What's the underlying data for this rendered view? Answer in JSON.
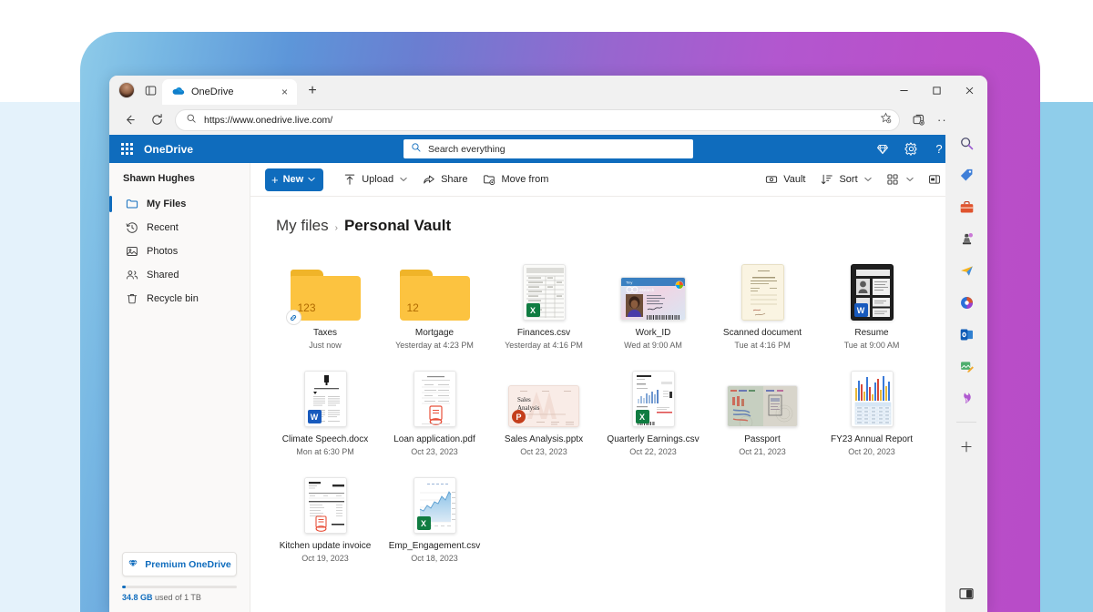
{
  "browser": {
    "tab": {
      "title": "OneDrive",
      "favicon": "onedrive-cloud-icon",
      "close": "×"
    },
    "new_tab_label": "+",
    "window_controls": {
      "minimize": "–",
      "maximize": "☐",
      "close": "✕"
    },
    "url": "https://www.onedrive.live.com/",
    "nav": {
      "back": "←",
      "refresh": "⟳"
    },
    "toolbar_right": {
      "favorites": "favorites-add-icon",
      "collections": "collections-icon",
      "settings_more": "···",
      "copilot": "b"
    }
  },
  "onedrive_header": {
    "app_launcher": "waffle-icon",
    "brand": "OneDrive",
    "search_placeholder": "Search everything",
    "actions": [
      {
        "name": "premium-diamond-icon",
        "glyph": "◇"
      },
      {
        "name": "settings-gear-icon",
        "glyph": "⚙"
      },
      {
        "name": "help-icon",
        "glyph": "?"
      }
    ]
  },
  "sidebar": {
    "user_name": "Shawn Hughes",
    "items": [
      {
        "label": "My Files",
        "icon": "folder-icon",
        "active": true
      },
      {
        "label": "Recent",
        "icon": "clock-history-icon",
        "active": false
      },
      {
        "label": "Photos",
        "icon": "photo-icon",
        "active": false
      },
      {
        "label": "Shared",
        "icon": "people-icon",
        "active": false
      },
      {
        "label": "Recycle bin",
        "icon": "trash-icon",
        "active": false
      }
    ],
    "premium_button": "Premium OneDrive",
    "storage_used": "34.8 GB",
    "storage_suffix": "used of 1 TB",
    "storage_percent": 3.4
  },
  "command_bar": {
    "new_label": "New",
    "new_chevron": "⌄",
    "items": [
      {
        "label": "Upload",
        "icon": "upload-icon",
        "chevron": "⌄"
      },
      {
        "label": "Share",
        "icon": "share-icon",
        "chevron": ""
      },
      {
        "label": "Move from",
        "icon": "move-from-icon",
        "chevron": ""
      }
    ],
    "right_items": [
      {
        "label": "Vault",
        "icon": "vault-icon",
        "chevron": ""
      },
      {
        "label": "Sort",
        "icon": "sort-icon",
        "chevron": "⌄"
      },
      {
        "label": "",
        "icon": "view-tiles-icon",
        "chevron": "⌄"
      },
      {
        "label": "Info",
        "icon": "info-panel-icon",
        "chevron": ""
      }
    ]
  },
  "breadcrumb": {
    "parent": "My files",
    "separator": "›",
    "current": "Personal Vault"
  },
  "files": [
    {
      "name": "Taxes",
      "date": "Just now",
      "kind": "folder",
      "count": "123",
      "shared": true
    },
    {
      "name": "Mortgage",
      "date": "Yesterday at 4:23 PM",
      "kind": "folder",
      "count": "12",
      "shared": false
    },
    {
      "name": "Finances.csv",
      "date": "Yesterday at 4:16 PM",
      "kind": "doc",
      "badge": "excel",
      "badge_text": "X",
      "thumb": "tax-form"
    },
    {
      "name": "Work_ID",
      "date": "Wed at 9:00 AM",
      "kind": "image-wide",
      "badge": "",
      "badge_text": "",
      "thumb": "id-card"
    },
    {
      "name": "Scanned document",
      "date": "Tue at 4:16 PM",
      "kind": "doc",
      "badge": "",
      "badge_text": "",
      "thumb": "scanned-letter"
    },
    {
      "name": "Resume",
      "date": "Tue at 9:00 AM",
      "kind": "doc",
      "badge": "word",
      "badge_text": "W",
      "thumb": "resume-dark"
    },
    {
      "name": "Climate Speech.docx",
      "date": "Mon at 6:30 PM",
      "kind": "doc",
      "badge": "word",
      "badge_text": "W",
      "thumb": "article"
    },
    {
      "name": "Loan application.pdf",
      "date": "Oct 23, 2023",
      "kind": "doc",
      "badge": "pdf",
      "badge_text": "",
      "thumb": "form"
    },
    {
      "name": "Sales Analysis.pptx",
      "date": "Oct 23, 2023",
      "kind": "slide",
      "badge": "ppt",
      "badge_text": "P",
      "thumb": "slide-sales",
      "slide_title": "Sales\nAnalysis"
    },
    {
      "name": "Quarterly Earnings.csv",
      "date": "Oct 22, 2023",
      "kind": "doc",
      "badge": "excel",
      "badge_text": "X",
      "thumb": "billing-statement"
    },
    {
      "name": "Passport",
      "date": "Oct 21, 2023",
      "kind": "image-wide",
      "badge": "",
      "badge_text": "",
      "thumb": "passport"
    },
    {
      "name": "FY23 Annual Report",
      "date": "Oct 20, 2023",
      "kind": "doc",
      "badge": "",
      "badge_text": "",
      "thumb": "bar-chart-table"
    },
    {
      "name": "Kitchen update invoice",
      "date": "Oct 19, 2023",
      "kind": "doc",
      "badge": "pdf",
      "badge_text": "",
      "thumb": "invoice"
    },
    {
      "name": "Emp_Engagement.csv",
      "date": "Oct 18, 2023",
      "kind": "doc",
      "badge": "excel",
      "badge_text": "X",
      "thumb": "area-chart"
    }
  ],
  "edge_sidebar": {
    "items": [
      {
        "name": "search-icon",
        "glyph": "🔍"
      },
      {
        "name": "shopping-tag-icon",
        "glyph": "🏷"
      },
      {
        "name": "tools-briefcase-icon",
        "glyph": "🧰"
      },
      {
        "name": "games-icon",
        "glyph": "♟"
      },
      {
        "name": "outlook-send-icon",
        "glyph": "📨"
      },
      {
        "name": "office-365-icon",
        "glyph": "◑"
      },
      {
        "name": "outlook-icon",
        "glyph": "✉"
      },
      {
        "name": "designer-icon",
        "glyph": "🎨"
      },
      {
        "name": "image-creator-icon",
        "glyph": "🪶"
      },
      {
        "name": "add-sidebar-app-icon",
        "glyph": "＋"
      }
    ],
    "split_screen": "split-screen-icon"
  },
  "colors": {
    "accent_blue": "#0f6cbd",
    "folder_yellow": "#fcc340",
    "excel_green": "#107c41",
    "word_blue": "#185abd",
    "ppt_orange": "#c43e1c"
  }
}
